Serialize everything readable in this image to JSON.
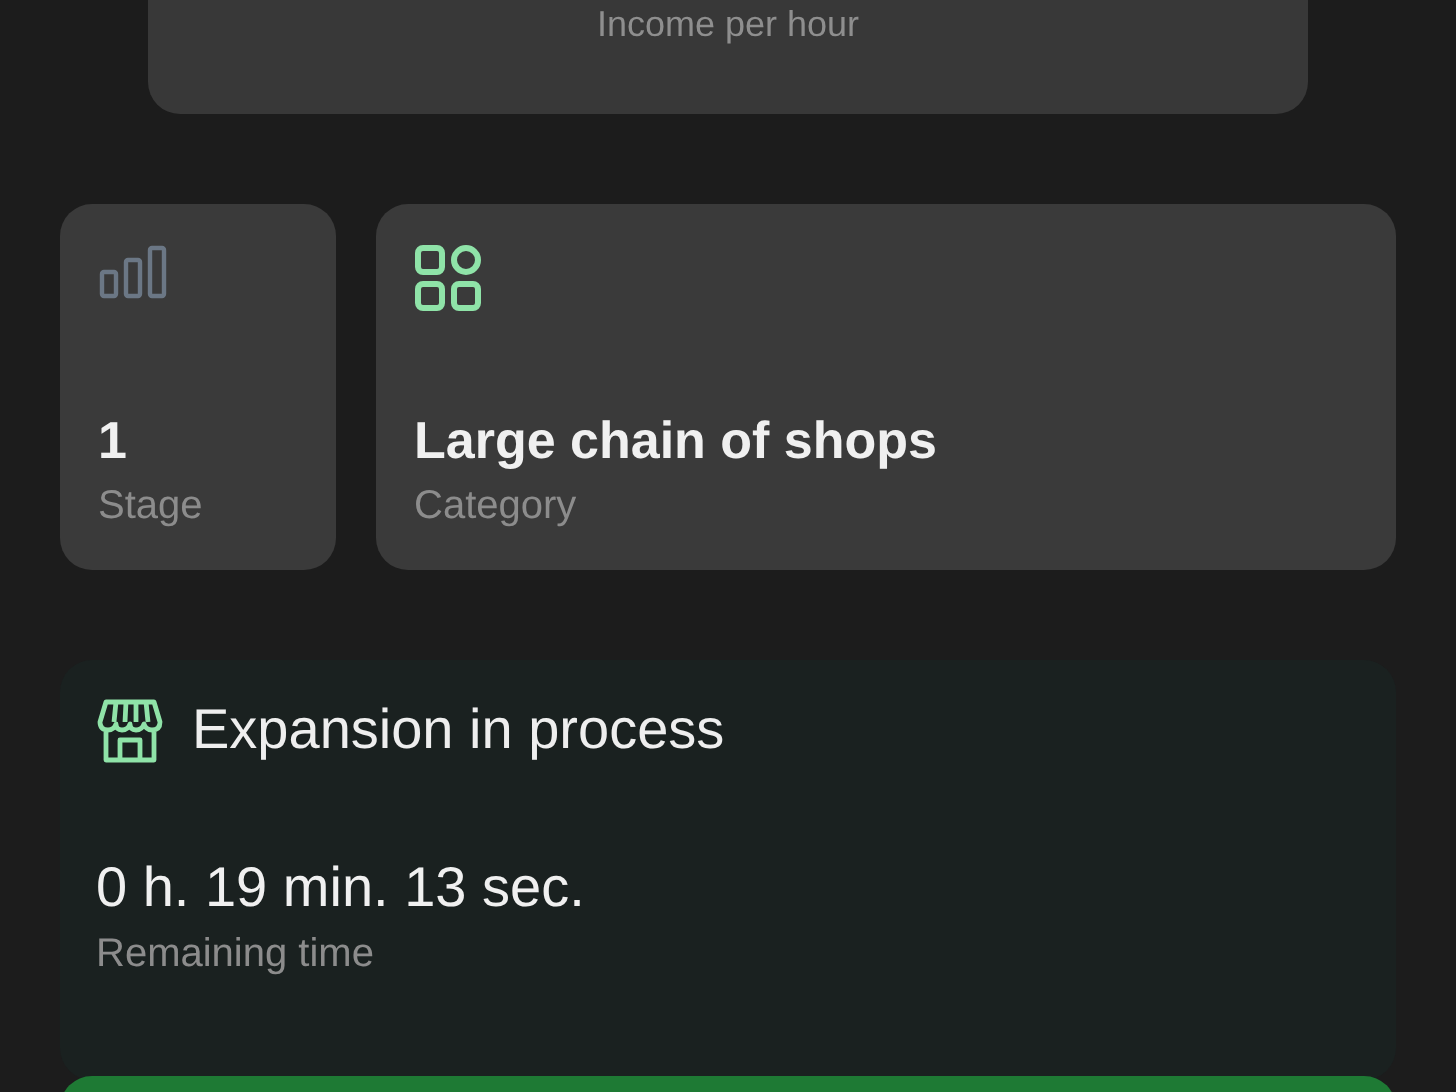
{
  "income_card": {
    "label": "Income per hour"
  },
  "stats": [
    {
      "kind": "stage",
      "value": "1",
      "label": "Stage"
    },
    {
      "kind": "category",
      "value": "Large chain of shops",
      "label": "Category"
    }
  ],
  "expansion": {
    "title": "Expansion in process",
    "time": "0 h. 19 min. 13 sec.",
    "time_label": "Remaining time"
  }
}
